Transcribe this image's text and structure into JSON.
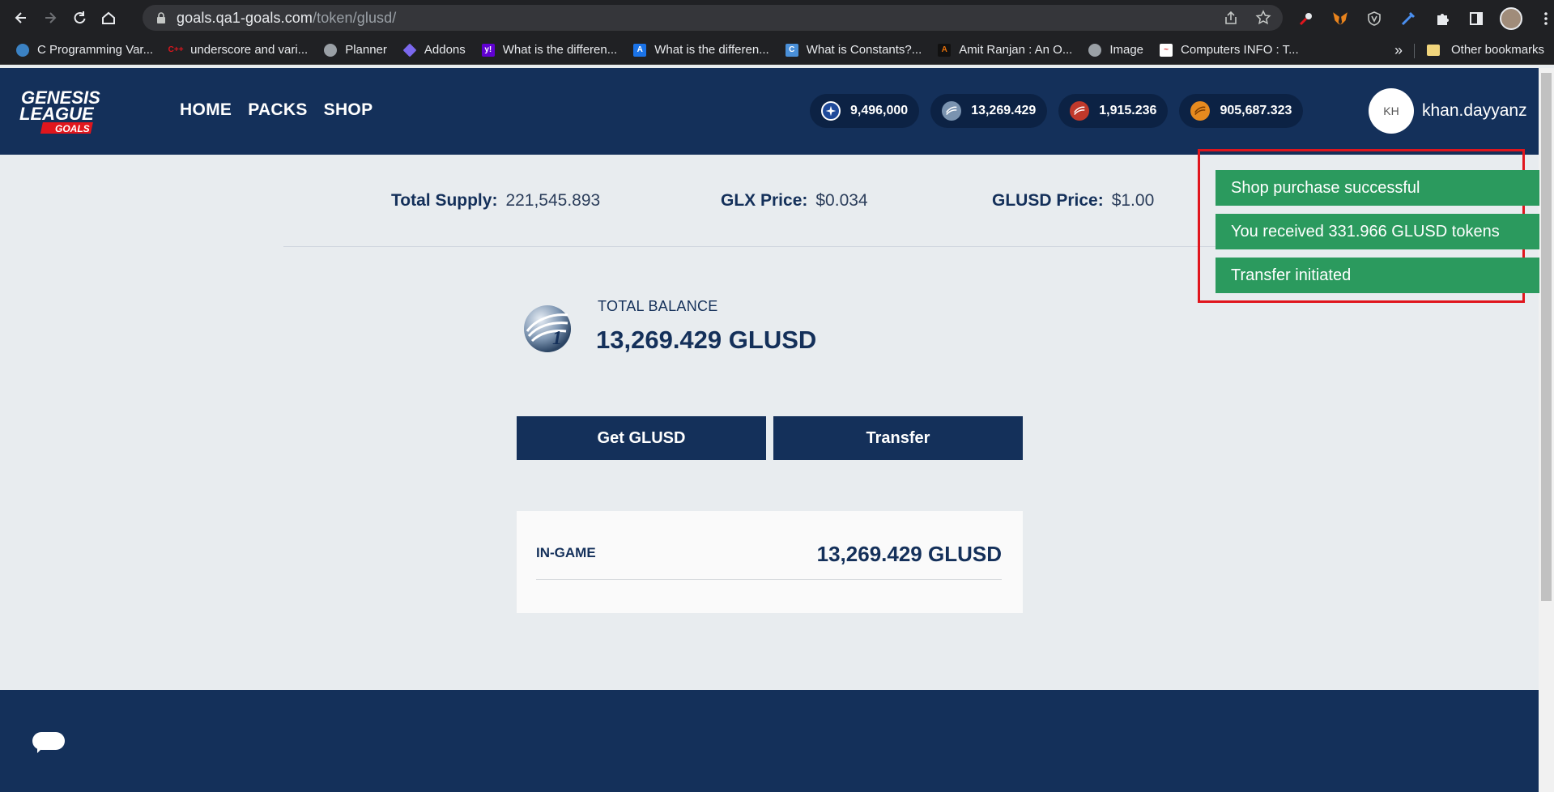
{
  "browser": {
    "url_host": "goals.qa1-goals.com",
    "url_path": "/token/glusd/",
    "bookmarks": [
      {
        "label": "C Programming Var...",
        "icon": "drupal-icon",
        "color": "#3b82c4"
      },
      {
        "label": "underscore and vari...",
        "icon": "cpp-icon",
        "color": "#c0392b"
      },
      {
        "label": "Planner",
        "icon": "globe-icon",
        "color": "#9aa0a6"
      },
      {
        "label": "Addons",
        "icon": "addons-icon",
        "color": "#7b68ee"
      },
      {
        "label": "What is the differen...",
        "icon": "yahoo-icon",
        "color": "#6001d2"
      },
      {
        "label": "What is the differen...",
        "icon": "font-icon",
        "color": "#1a73e8"
      },
      {
        "label": "What is Constants?...",
        "icon": "constants-icon",
        "color": "#4a90d9"
      },
      {
        "label": "Amit Ranjan : An O...",
        "icon": "amit-icon",
        "color": "#e8710a"
      },
      {
        "label": "Image",
        "icon": "globe-icon",
        "color": "#9aa0a6"
      },
      {
        "label": "Computers INFO : T...",
        "icon": "computers-icon",
        "color": "#d33"
      }
    ],
    "more": "»",
    "other_bookmarks": "Other bookmarks"
  },
  "nav": {
    "home": "HOME",
    "packs": "PACKS",
    "shop": "SHOP"
  },
  "logo": {
    "line1": "GENESIS",
    "line2": "LEAGUE",
    "line3": "GOALS"
  },
  "wallets": [
    {
      "amount": "9,496,000",
      "icon": "star-coin-icon",
      "color": "#1f4a9a"
    },
    {
      "amount": "13,269.429",
      "icon": "glusd-coin-icon",
      "color": "#7a93b0"
    },
    {
      "amount": "1,915.236",
      "icon": "red-coin-icon",
      "color": "#c0392b"
    },
    {
      "amount": "905,687.323",
      "icon": "orange-coin-icon",
      "color": "#e68a1f"
    }
  ],
  "user": {
    "initials": "KH",
    "username": "khan.dayyanz"
  },
  "stats": {
    "supply_label": "Total Supply:",
    "supply_value": "221,545.893",
    "glx_label": "GLX Price:",
    "glx_value": "$0.034",
    "glusd_label": "GLUSD Price:",
    "glusd_value": "$1.00"
  },
  "balance": {
    "label": "TOTAL BALANCE",
    "value": "13,269.429 GLUSD"
  },
  "buttons": {
    "get": "Get GLUSD",
    "transfer": "Transfer"
  },
  "ingame": {
    "label": "IN-GAME",
    "value": "13,269.429 GLUSD"
  },
  "toasts": [
    "Shop purchase successful",
    "You received 331.966 GLUSD tokens",
    "Transfer initiated"
  ],
  "colors": {
    "brand": "#14305a",
    "toast": "#2b9a5e",
    "highlight": "#e0161d",
    "background": "#e8ecef"
  }
}
